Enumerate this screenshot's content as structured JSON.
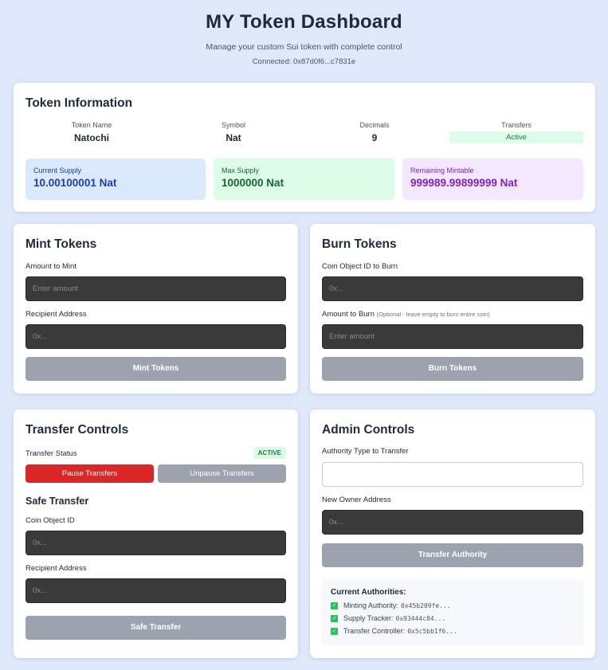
{
  "header": {
    "title": "MY Token Dashboard",
    "subtitle": "Manage your custom Sui token with complete control",
    "connected": "Connected: 0x87d0f6...c7831e"
  },
  "token_info": {
    "title": "Token Information",
    "name_label": "Token Name",
    "name_value": "Natochi",
    "symbol_label": "Symbol",
    "symbol_value": "Nat",
    "decimals_label": "Decimals",
    "decimals_value": "9",
    "transfers_label": "Transfers",
    "transfers_value": "Active",
    "current_supply_label": "Current Supply",
    "current_supply_value": "10.00100001 Nat",
    "max_supply_label": "Max Supply",
    "max_supply_value": "1000000 Nat",
    "remaining_label": "Remaining Mintable",
    "remaining_value": "999989.99899999 Nat"
  },
  "mint": {
    "title": "Mint Tokens",
    "amount_label": "Amount to Mint",
    "amount_placeholder": "Enter amount",
    "recipient_label": "Recipient Address",
    "recipient_placeholder": "0x...",
    "button": "Mint Tokens"
  },
  "burn": {
    "title": "Burn Tokens",
    "coin_label": "Coin Object ID to Burn",
    "coin_placeholder": "0x...",
    "amount_label": "Amount to Burn",
    "amount_hint": "(Optional - leave empty to burn entire coin)",
    "amount_placeholder": "Enter amount",
    "button": "Burn Tokens"
  },
  "transfer": {
    "title": "Transfer Controls",
    "status_label": "Transfer Status",
    "status_badge": "ACTIVE",
    "pause_button": "Pause Transfers",
    "unpause_button": "Unpause Transfers",
    "safe_title": "Safe Transfer",
    "coin_label": "Coin Object ID",
    "coin_placeholder": "0x...",
    "recipient_label": "Recipient Address",
    "recipient_placeholder": "0x...",
    "safe_button": "Safe Transfer"
  },
  "admin": {
    "title": "Admin Controls",
    "authority_label": "Authority Type to Transfer",
    "authority_value": "",
    "owner_label": "New Owner Address",
    "owner_placeholder": "0x...",
    "button": "Transfer Authority",
    "authorities_title": "Current Authorities:",
    "authorities": [
      {
        "label": "Minting Authority:",
        "value": "0x45b209fe..."
      },
      {
        "label": "Supply Tracker:",
        "value": "0x93444c84..."
      },
      {
        "label": "Transfer Controller:",
        "value": "0x5c5bb1f6..."
      }
    ]
  },
  "colors": {
    "background": "#dfe8fb",
    "current_supply": "#1e40af",
    "max_supply": "#166534",
    "remaining": "#7e22ce",
    "danger": "#dc2626",
    "active": "#15803d"
  }
}
